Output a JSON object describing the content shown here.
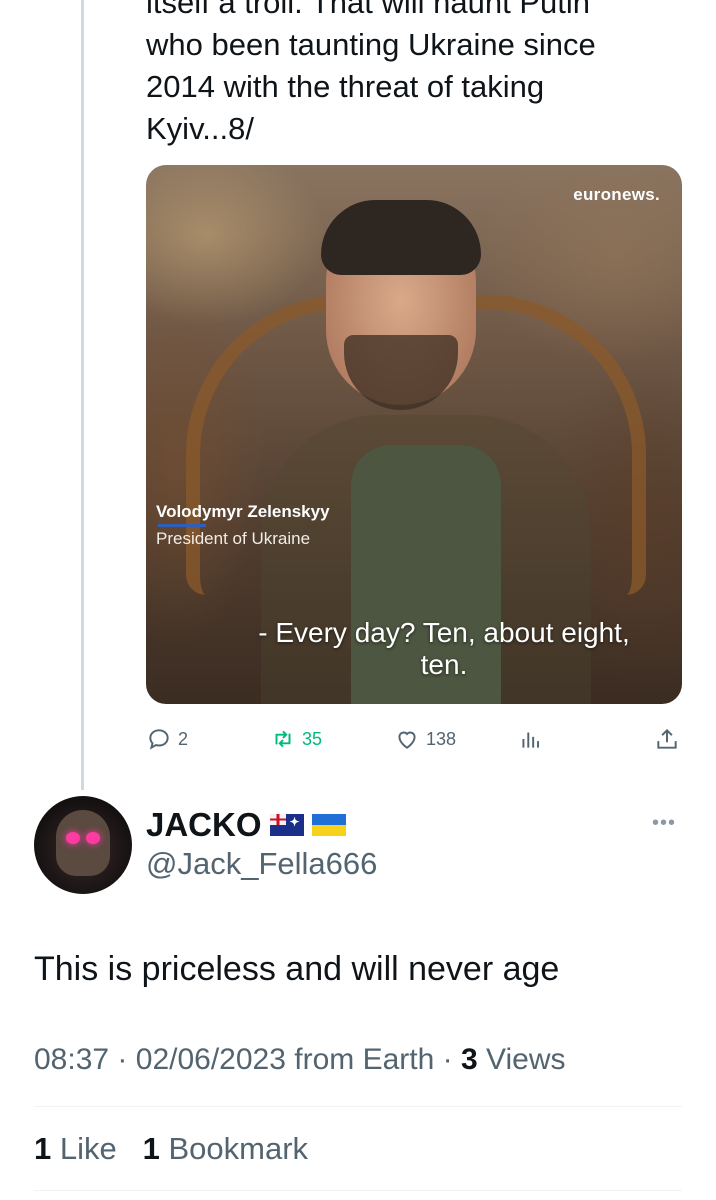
{
  "quoted_tweet": {
    "text_lines": [
      "itself a troll. That will haunt Putin",
      "who been taunting Ukraine since",
      "2014 with the threat of taking",
      "Kyiv...8/"
    ],
    "media": {
      "brand": "euronews.",
      "caption_name": "Volodymyr Zelenskyy",
      "caption_role": "President of Ukraine",
      "subtitle_line1": "- Every day? Ten, about eight,",
      "subtitle_line2": "ten."
    },
    "actions": {
      "replies": "2",
      "retweets": "35",
      "likes": "138",
      "reply_icon": "reply-icon",
      "retweet_icon": "retweet-icon",
      "like_icon": "heart-icon",
      "views_icon": "views-icon",
      "share_icon": "share-icon",
      "retweet_color": "#00ba7c"
    }
  },
  "reply": {
    "display_name": "JACKO",
    "flags": [
      "australia-flag",
      "ukraine-flag"
    ],
    "handle": "@Jack_Fella666",
    "more_label": "•••",
    "text": "This is priceless and will never age",
    "time": "08:37",
    "date": "02/06/2023",
    "source": "from Earth",
    "separator": "·",
    "views_count": "3",
    "views_label": "Views",
    "likes_count": "1",
    "likes_label": "Like",
    "bookmarks_count": "1",
    "bookmarks_label": "Bookmark"
  },
  "colors": {
    "text_primary": "#0f1419",
    "text_secondary": "#536471",
    "thread_line": "#cfd9de"
  }
}
